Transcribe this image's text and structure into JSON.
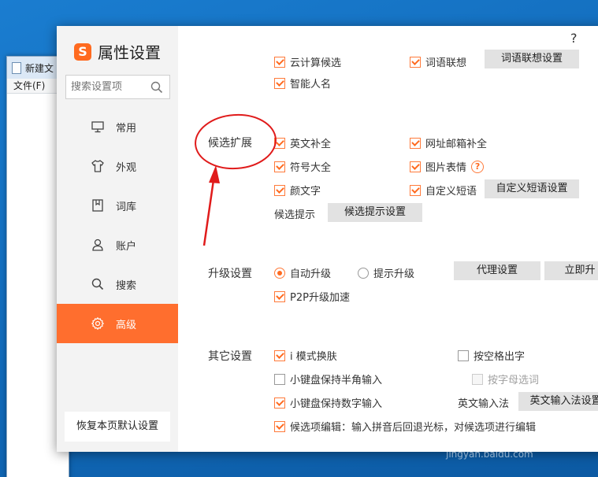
{
  "background_window": {
    "title": "新建文",
    "menu": "文件(F)"
  },
  "dialog": {
    "title": "属性设置",
    "logo_glyph": "S",
    "help": "?",
    "search": {
      "placeholder": "搜索设置项"
    },
    "nav": [
      {
        "label": "常用",
        "icon": "monitor-icon"
      },
      {
        "label": "外观",
        "icon": "tshirt-icon"
      },
      {
        "label": "词库",
        "icon": "book-icon"
      },
      {
        "label": "账户",
        "icon": "user-icon"
      },
      {
        "label": "搜索",
        "icon": "search-icon"
      },
      {
        "label": "高级",
        "icon": "gear-icon",
        "active": true
      }
    ],
    "restore_default": "恢复本页默认设置"
  },
  "content": {
    "top": {
      "cloud": "云计算候选",
      "word_assoc": "词语联想",
      "word_assoc_btn": "词语联想设置",
      "smart_name": "智能人名"
    },
    "candidate": {
      "title": "候选扩展",
      "english_complete": "英文补全",
      "url_email": "网址邮箱补全",
      "symbols": "符号大全",
      "image_emoji": "图片表情",
      "kaomoji": "颜文字",
      "custom_phrase": "自定义短语",
      "custom_phrase_btn": "自定义短语设置",
      "hint_label": "候选提示",
      "hint_btn": "候选提示设置"
    },
    "upgrade": {
      "title": "升级设置",
      "auto": "自动升级",
      "prompt": "提示升级",
      "proxy_btn": "代理设置",
      "now_btn": "立即升",
      "p2p": "P2P升级加速"
    },
    "other": {
      "title": "其它设置",
      "i_mode": "i 模式换肤",
      "space_output": "按空格出字",
      "half_width": "小键盘保持半角输入",
      "letter_select": "按字母选词",
      "numeric": "小键盘保持数字输入",
      "en_method_label": "英文输入法",
      "en_method_btn": "英文输入法设置",
      "edit_candidate": "候选项编辑：输入拼音后回退光标，对候选项进行编辑"
    }
  },
  "watermark": "jingyan.baidu.com",
  "colors": {
    "accent": "#ff6e2e",
    "annotation": "#e01b1b",
    "desktop": "#1169b8"
  }
}
